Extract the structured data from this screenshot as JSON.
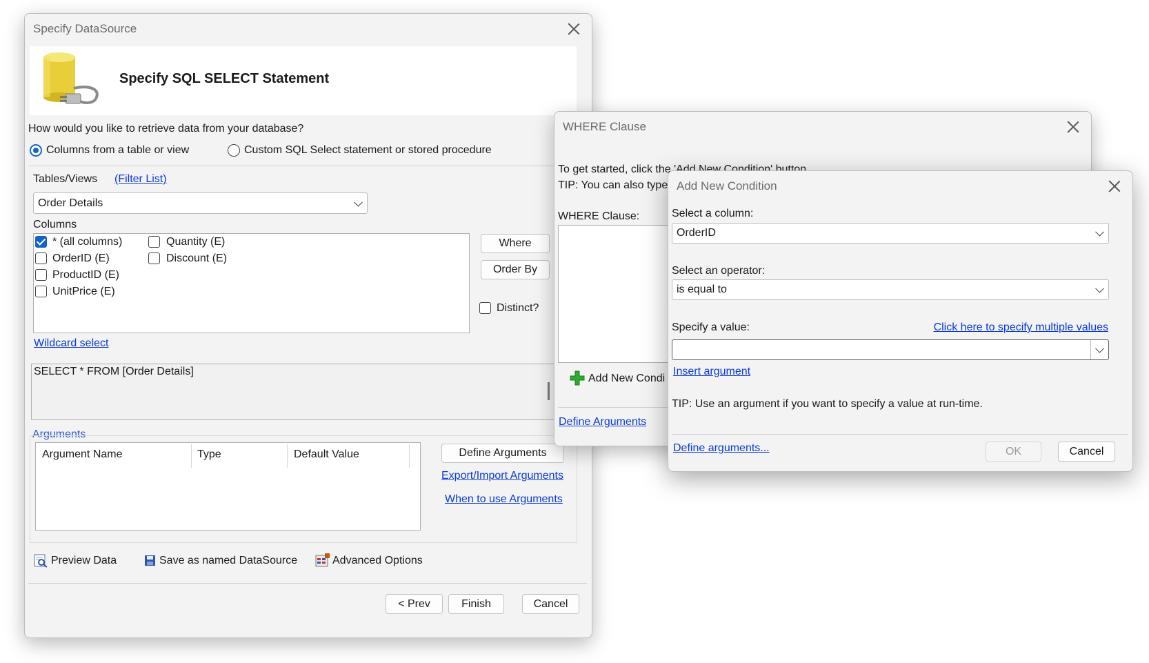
{
  "main": {
    "title": "Specify DataSource",
    "heading": "Specify SQL SELECT Statement",
    "question": "How would you like to retrieve data from your database?",
    "radio_table": "Columns from a table or view",
    "radio_custom": "Custom SQL Select statement or stored procedure",
    "tables_label": "Tables/Views",
    "filter_link": "(Filter List)",
    "table_selected": "Order Details",
    "columns_label": "Columns",
    "columns": [
      {
        "label": "* (all columns)",
        "checked": true
      },
      {
        "label": "OrderID (E)",
        "checked": false
      },
      {
        "label": "ProductID (E)",
        "checked": false
      },
      {
        "label": "UnitPrice (E)",
        "checked": false
      },
      {
        "label": "Quantity (E)",
        "checked": false
      },
      {
        "label": "Discount (E)",
        "checked": false
      }
    ],
    "where_btn": "Where",
    "orderby_btn": "Order By",
    "distinct": "Distinct?",
    "wildcard_link": "Wildcard select",
    "sql_text": "SELECT * FROM [Order Details]",
    "arguments_label": "Arguments",
    "arg_headers": [
      "Argument Name",
      "Type",
      "Default Value"
    ],
    "define_args_btn": "Define Arguments",
    "export_link": "Export/Import Arguments",
    "when_link": "When to use Arguments",
    "preview": "Preview Data",
    "save_named": "Save as named DataSource",
    "advanced": "Advanced Options",
    "prev_btn": "< Prev",
    "finish_btn": "Finish",
    "cancel_btn": "Cancel"
  },
  "where": {
    "title": "WHERE Clause",
    "hint1": "To get started, click the 'Add New Condition' button.",
    "hint2": "TIP: You can also type",
    "label": "WHERE Clause:",
    "add_btn": "Add New Condi",
    "define_link": "Define Arguments"
  },
  "cond": {
    "title": "Add New Condition",
    "col_label": "Select a column:",
    "col_value": "OrderID",
    "op_label": "Select an operator:",
    "op_value": "is equal to",
    "val_label": "Specify a value:",
    "multi_link": "Click here to specify multiple values",
    "value": "",
    "insert_link": "Insert argument",
    "tip": "TIP: Use an argument if you want to specify a value at run-time.",
    "define_link": "Define arguments...",
    "ok_btn": "OK",
    "cancel_btn": "Cancel"
  },
  "colors": {
    "accent": "#1464c8",
    "link": "#0a39d6",
    "window_bg": "#f3f3f3",
    "plus_green": "#2eaa2e",
    "db_yellow": "#e8cf3a"
  }
}
